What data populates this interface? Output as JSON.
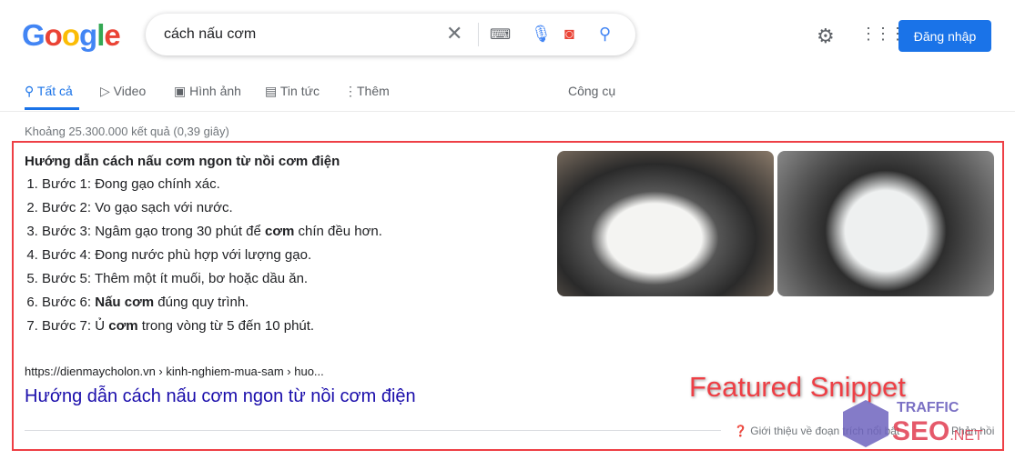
{
  "header": {
    "logo": "Google",
    "query": "cách nấu cơm",
    "signin": "Đăng nhập"
  },
  "tabs": [
    {
      "label": "Tất cả",
      "active": true
    },
    {
      "label": "Video"
    },
    {
      "label": "Hình ảnh"
    },
    {
      "label": "Tin tức"
    },
    {
      "label": "Thêm"
    }
  ],
  "tools": "Công cụ",
  "stats": "Khoảng 25.300.000 kết quả (0,39 giây)",
  "snippet": {
    "title": "Hướng dẫn cách nấu cơm ngon từ nồi cơm điện",
    "steps": [
      {
        "pre": "Bước 1: Đong gạo chính xác.",
        "bold": "",
        "post": ""
      },
      {
        "pre": "Bước 2: Vo gạo sạch với nước.",
        "bold": "",
        "post": ""
      },
      {
        "pre": "Bước 3: Ngâm gạo trong 30 phút để ",
        "bold": "cơm",
        "post": " chín đều hơn."
      },
      {
        "pre": "Bước 4: Đong nước phù hợp với lượng gạo.",
        "bold": "",
        "post": ""
      },
      {
        "pre": "Bước 5: Thêm một ít muối, bơ hoặc dầu ăn.",
        "bold": "",
        "post": ""
      },
      {
        "pre": "Bước 6: ",
        "bold": "Nấu cơm",
        "post": " đúng quy trình."
      },
      {
        "pre": "Bước 7: Ủ ",
        "bold": "cơm",
        "post": " trong vòng từ 5 đến 10 phút."
      }
    ],
    "cite": "https://dienmaycholon.vn › kinh-nghiem-mua-sam › huo...",
    "link": "Hướng dẫn cách nấu cơm ngon từ nồi cơm điện",
    "about": "Giới thiệu về đoạn trích nổi bật",
    "feedback": "Phản hồi"
  },
  "annotation": "Featured Snippet",
  "watermark": {
    "top": "TRAFFIC",
    "main": "SEO",
    "suffix": ".NET"
  },
  "colors": {
    "accent": "#1a73e8",
    "highlight": "#ee3f45",
    "link": "#1a0dab"
  }
}
